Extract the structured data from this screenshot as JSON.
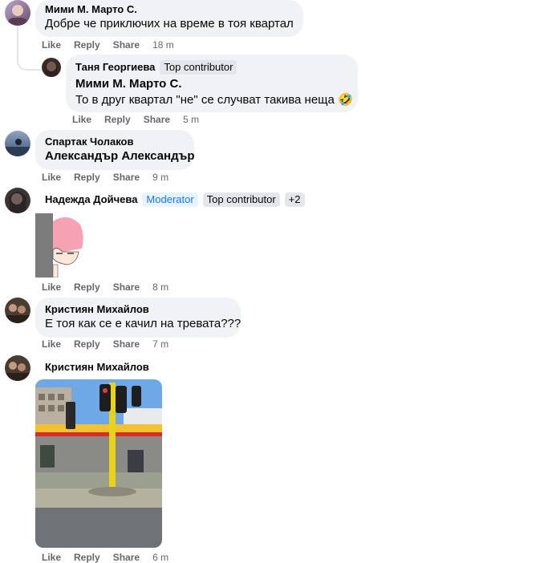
{
  "comments": [
    {
      "author": "Мими М. Марто С.",
      "text": "Добре че приключих на време в тоя квартал",
      "time": "18 m"
    },
    {
      "author": "Таня Георгиева",
      "badge": "Top contributor",
      "mention": "Мими М. Марто С.",
      "text": "То в друг квартал \"не\" се случват такива неща",
      "emoji": "🤣",
      "time": "5 m"
    },
    {
      "author": "Спартак Чолаков",
      "text": "Александър Александър",
      "time": "9 m"
    },
    {
      "author": "Надежда Дойчева",
      "badges": [
        "Moderator",
        "Top contributor",
        "+2"
      ],
      "time": "8 m"
    },
    {
      "author": "Кристиян Михайлов",
      "text": "Е тоя как се е качил на тревата???",
      "time": "7 m"
    },
    {
      "author": "Кристиян Михайлов",
      "time": "6 m"
    }
  ],
  "actions": {
    "like": "Like",
    "reply": "Reply",
    "share": "Share"
  },
  "colors": {
    "bubble": "#f0f2f5",
    "muted": "#65676b",
    "moderator_blue": "#1877f2"
  },
  "icons": [
    "avatar",
    "sticker-image",
    "street-photo"
  ]
}
